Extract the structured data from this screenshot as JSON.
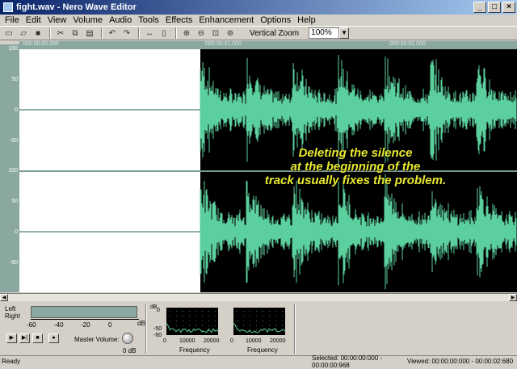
{
  "window": {
    "title": "fight.wav - Nero Wave Editor"
  },
  "menu": [
    "File",
    "Edit",
    "View",
    "Volume",
    "Audio",
    "Tools",
    "Effects",
    "Enhancement",
    "Options",
    "Help"
  ],
  "toolbar": {
    "vertical_zoom_label": "Vertical Zoom",
    "zoom_value": "100%"
  },
  "axis": {
    "y_ticks_top": [
      "100",
      "50",
      "0",
      "-50"
    ],
    "y_ticks_bottom": [
      "100",
      "50",
      "0",
      "-50"
    ],
    "time_labels": [
      "000:00:00.000",
      "000:00:01.000",
      "000:00:02.000"
    ]
  },
  "overlay": {
    "line1": "Deleting the silence",
    "line2": "at the beginning of the",
    "line3": "track usually fixes the problem."
  },
  "meters": {
    "left_label": "Left",
    "right_label": "Right",
    "scale": [
      "-60",
      "-40",
      "-20",
      "0"
    ],
    "db_unit": "dB",
    "master_volume_label": "Master Volume:",
    "master_volume_value": "0 dB"
  },
  "spectrum": {
    "y_ticks": [
      "0",
      "-50",
      "-60"
    ],
    "x_ticks": [
      "0",
      "10000",
      "20000"
    ],
    "xlabel": "Frequency"
  },
  "status": {
    "ready": "Ready",
    "selected": "Selected: 00:00:00:000 - 00:00:00:968",
    "viewed": "Viewed: 00:00:00:000 - 00:00:02:680"
  },
  "colors": {
    "waveform": "#5ccf9e",
    "axis_bg": "#8aa8a0",
    "overlay_text": "#e8ea30",
    "title_grad_start": "#0a246a"
  }
}
